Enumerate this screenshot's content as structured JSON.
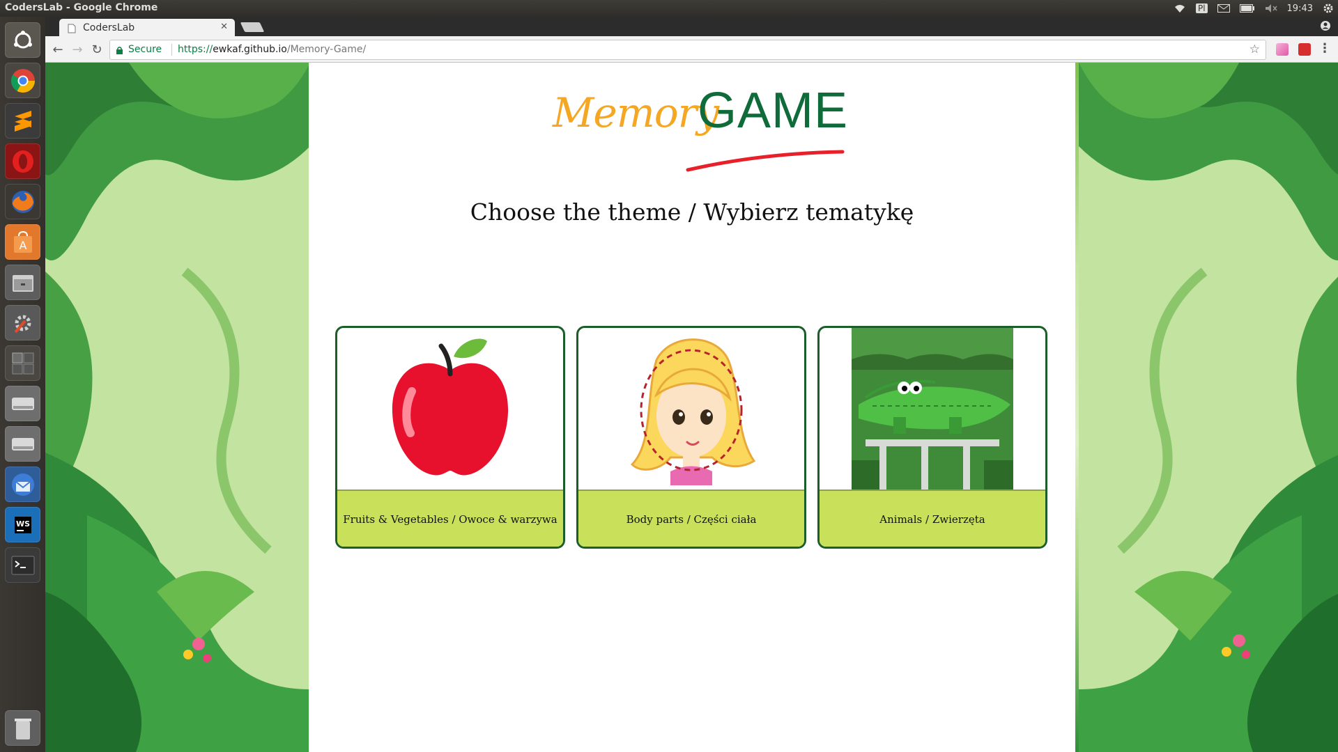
{
  "os": {
    "window_title": "CodersLab - Google Chrome",
    "keyboard_layout": "Pl",
    "clock": "19:43"
  },
  "launcher": {
    "items": [
      {
        "name": "ubuntu-dash",
        "color": "#5a5650"
      },
      {
        "name": "chrome",
        "color": "#4a4742"
      },
      {
        "name": "sublime-text",
        "color": "#3b3b3b"
      },
      {
        "name": "opera",
        "color": "#b01b1b"
      },
      {
        "name": "firefox",
        "color": "#e07a1f"
      },
      {
        "name": "software-center",
        "color": "#e2782c"
      },
      {
        "name": "files",
        "color": "#6a6a6a"
      },
      {
        "name": "system-settings",
        "color": "#595959"
      },
      {
        "name": "workspace-switcher",
        "color": "#4a4742"
      },
      {
        "name": "disk",
        "color": "#7d7d7d"
      },
      {
        "name": "disk-2",
        "color": "#7d7d7d"
      },
      {
        "name": "thunderbird",
        "color": "#2f5d9a"
      },
      {
        "name": "webstorm",
        "color": "#1b6fb8"
      },
      {
        "name": "terminal",
        "color": "#2a2a2a"
      },
      {
        "name": "trash",
        "color": "#6a6a6a"
      }
    ]
  },
  "browser": {
    "tab_title": "CodersLab",
    "secure_label": "Secure",
    "url_scheme": "https://",
    "url_host": "ewkaf.github.io",
    "url_path": "/Memory-Game/"
  },
  "page": {
    "logo_memory": "Memory",
    "logo_game": "GAME",
    "subtitle": "Choose the theme / Wybierz tematykę",
    "themes": [
      {
        "label": "Fruits & Vegetables / Owoce & warzywa",
        "image": "apple"
      },
      {
        "label": "Body parts / Części ciała",
        "image": "girl-face"
      },
      {
        "label": "Animals / Zwierzęta",
        "image": "crocodile"
      }
    ]
  },
  "colors": {
    "accent_green": "#0f6b3a",
    "accent_orange": "#f5a623",
    "card_label_bg": "#c9e05a",
    "card_border": "#1b5e2a",
    "secure_green": "#0b8043"
  }
}
